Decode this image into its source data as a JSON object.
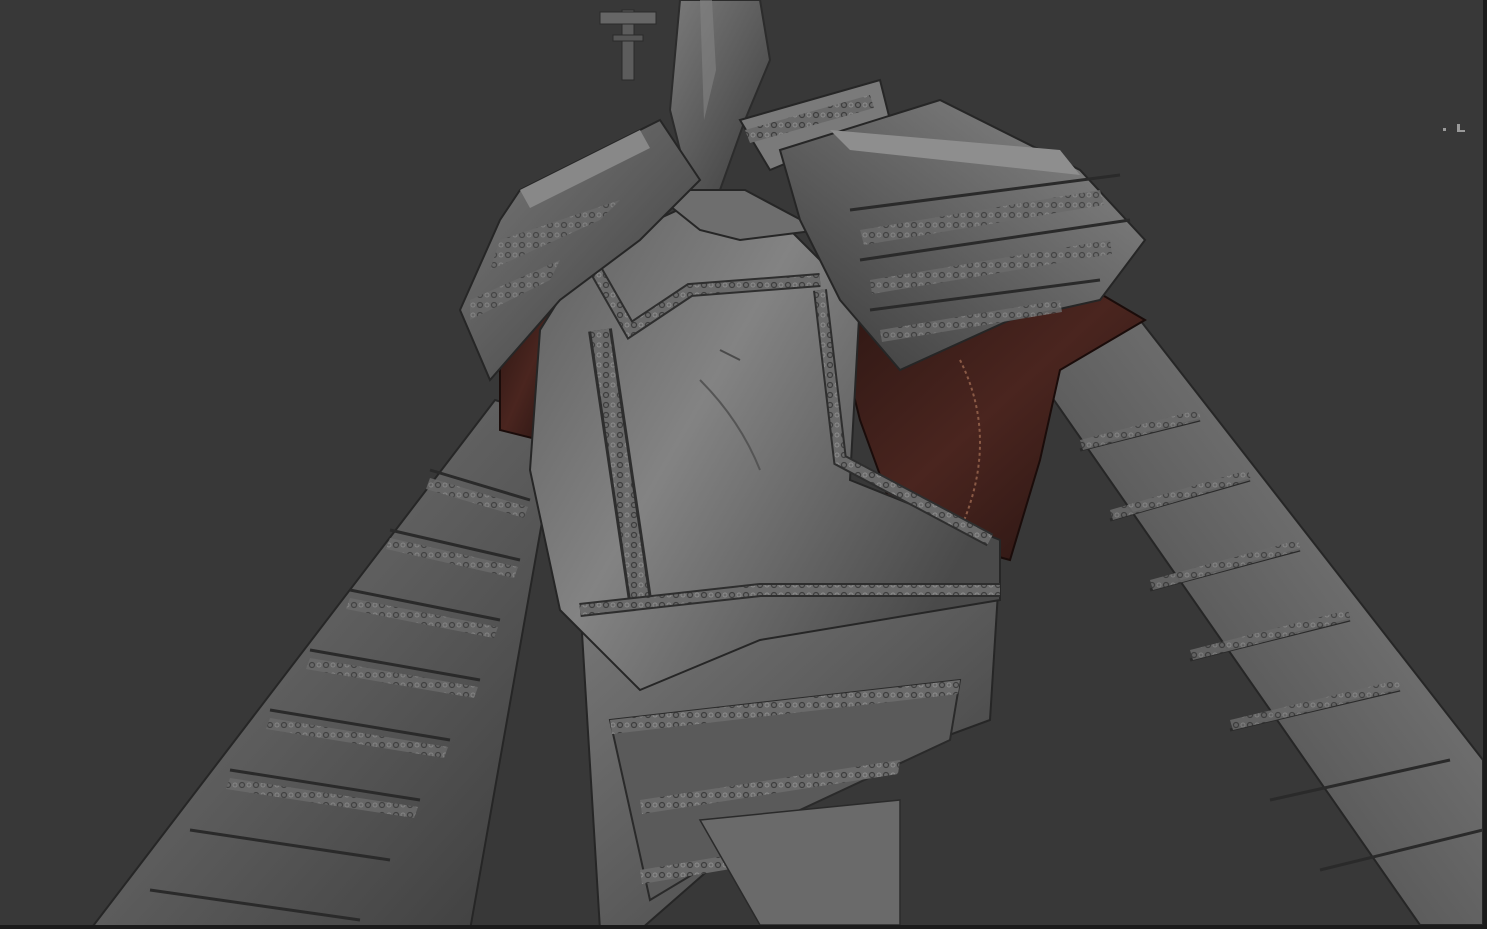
{
  "app": {
    "viewport_name": "3d-sculpt-viewport"
  },
  "colors": {
    "background": "#383838",
    "frame": "#1b1b1b",
    "armor": "#5e5e5e",
    "armor_highlight": "#8a8a8a",
    "armor_shadow": "#2f2f2f",
    "cloth": "#3a1f1a",
    "cloth_highlight": "#5a2e25"
  },
  "icons": {
    "nav_gizmo": "view-navigation-gizmo-icon"
  }
}
